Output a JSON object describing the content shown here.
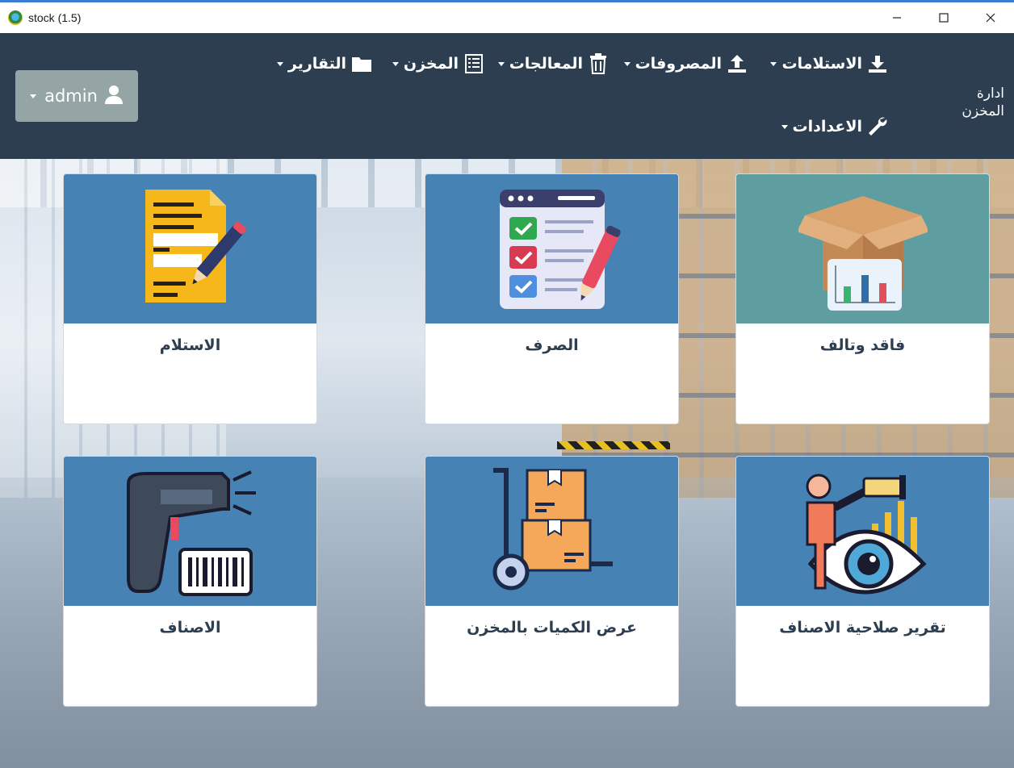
{
  "window": {
    "title": "stock (1.5)"
  },
  "navbar": {
    "brand": "ادارة المخزن",
    "items": [
      {
        "label": "الاستلامات",
        "icon": "download-icon"
      },
      {
        "label": "المصروفات",
        "icon": "upload-icon"
      },
      {
        "label": "المعالجات",
        "icon": "trash-icon"
      },
      {
        "label": "المخزن",
        "icon": "list-icon"
      },
      {
        "label": "التقارير",
        "icon": "folder-icon"
      },
      {
        "label": "الاعدادات",
        "icon": "wrench-icon"
      }
    ],
    "user": {
      "label": "admin",
      "icon": "user-icon"
    }
  },
  "cards": [
    {
      "title": "فاقد وتالف",
      "icon": "damaged-box-chart-icon"
    },
    {
      "title": "الصرف",
      "icon": "checklist-icon"
    },
    {
      "title": "الاستلام",
      "icon": "document-pencil-icon"
    },
    {
      "title": "تقرير صلاحية الاصناف",
      "icon": "spyglass-eye-icon"
    },
    {
      "title": "عرض الكميات بالمخزن",
      "icon": "hand-truck-boxes-icon"
    },
    {
      "title": "الاصناف",
      "icon": "barcode-scanner-icon"
    }
  ],
  "colors": {
    "navbar": "#2c3e50",
    "card_header": "#4682b4",
    "card_header_teal": "#5f9ea0",
    "admin_button": "#95a5a6"
  }
}
